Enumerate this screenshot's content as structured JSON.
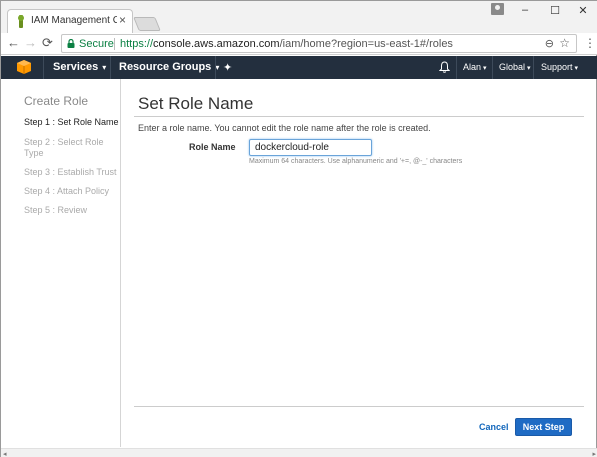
{
  "browser": {
    "tab_title": "IAM Management Conso",
    "tab_close": "×",
    "window_minimize": "–",
    "window_maximize": "☐",
    "window_close": "✕",
    "back": "←",
    "forward": "→",
    "reload": "⟳",
    "secure_label": "Secure",
    "url_scheme": "https://",
    "url_host": "console.aws.amazon.com",
    "url_path": "/iam/home?region=us-east-1#/roles",
    "zoom": "⊖",
    "bookmark": "☆",
    "menu": "⋮"
  },
  "aws_nav": {
    "services": "Services",
    "resource_groups": "Resource Groups",
    "pin": "✦",
    "user": "Alan",
    "region": "Global",
    "support": "Support",
    "caret": "▾",
    "colors": {
      "background": "#232f3e",
      "logo": "#f90"
    }
  },
  "sidebar": {
    "title": "Create Role",
    "steps": [
      {
        "label": "Step 1 : Set Role Name",
        "active": true
      },
      {
        "label": "Step 2 : Select Role Type",
        "active": false
      },
      {
        "label": "Step 3 : Establish Trust",
        "active": false
      },
      {
        "label": "Step 4 : Attach Policy",
        "active": false
      },
      {
        "label": "Step 5 : Review",
        "active": false
      }
    ]
  },
  "main": {
    "title": "Set Role Name",
    "instructions": "Enter a role name. You cannot edit the role name after the role is created.",
    "role_name_label": "Role Name",
    "role_name_value": "dockercloud-role",
    "help_text": "Maximum 64 characters. Use alphanumeric and '+=, @-_' characters",
    "cancel_label": "Cancel",
    "next_label": "Next Step",
    "colors": {
      "primary_button": "#1f6bc4",
      "link": "#1166bb"
    }
  },
  "scrollbar": {
    "left_arrow": "◂",
    "right_arrow": "▸"
  }
}
